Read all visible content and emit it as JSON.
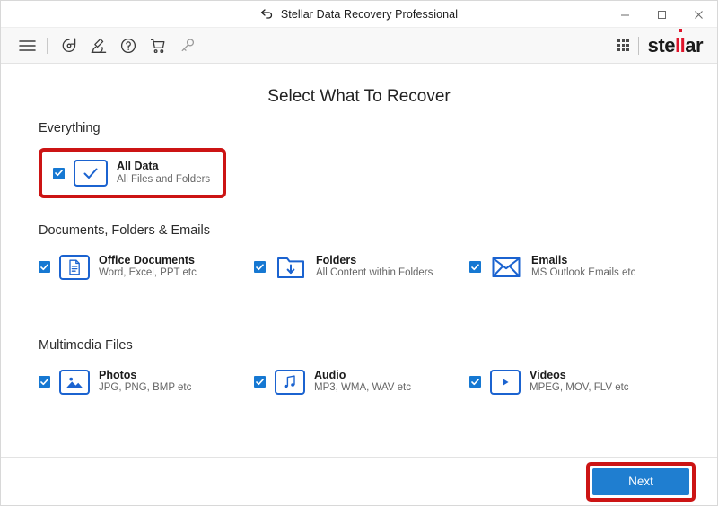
{
  "window": {
    "title": "Stellar Data Recovery Professional",
    "back_icon": "back-arrow-icon",
    "controls": {
      "minimize": "minimize-icon",
      "maximize": "maximize-icon",
      "close": "close-icon"
    }
  },
  "toolbar": {
    "icons": [
      {
        "name": "hamburger-menu-icon",
        "title": "Menu"
      },
      {
        "name": "recovery-history-icon",
        "title": "Recovery"
      },
      {
        "name": "microscope-icon",
        "title": "Monitor Drive"
      },
      {
        "name": "help-icon",
        "title": "Help"
      },
      {
        "name": "cart-icon",
        "title": "Buy Now"
      },
      {
        "name": "key-icon",
        "title": "Activation"
      }
    ],
    "logo": {
      "grid": "app-grid-icon",
      "brand_prefix": "ste",
      "brand_highlight": "ll",
      "brand_suffix": "ar"
    }
  },
  "main": {
    "page_title": "Select What To Recover",
    "sections": [
      {
        "id": "everything",
        "heading": "Everything",
        "highlighted": true,
        "items": [
          {
            "id": "all-data",
            "title": "All Data",
            "subtitle": "All Files and Folders",
            "icon": "check-tile-icon",
            "checked": true
          }
        ]
      },
      {
        "id": "documents",
        "heading": "Documents, Folders & Emails",
        "highlighted": false,
        "items": [
          {
            "id": "office-documents",
            "title": "Office Documents",
            "subtitle": "Word, Excel, PPT etc",
            "icon": "document-icon",
            "checked": true
          },
          {
            "id": "folders",
            "title": "Folders",
            "subtitle": "All Content within Folders",
            "icon": "folder-download-icon",
            "checked": true
          },
          {
            "id": "emails",
            "title": "Emails",
            "subtitle": "MS Outlook Emails etc",
            "icon": "envelope-icon",
            "checked": true
          }
        ]
      },
      {
        "id": "multimedia",
        "heading": "Multimedia Files",
        "highlighted": false,
        "items": [
          {
            "id": "photos",
            "title": "Photos",
            "subtitle": "JPG, PNG, BMP etc",
            "icon": "image-icon",
            "checked": true
          },
          {
            "id": "audio",
            "title": "Audio",
            "subtitle": "MP3, WMA, WAV etc",
            "icon": "music-note-icon",
            "checked": true
          },
          {
            "id": "videos",
            "title": "Videos",
            "subtitle": "MPEG, MOV, FLV etc",
            "icon": "play-icon",
            "checked": true
          }
        ]
      }
    ]
  },
  "footer": {
    "next_label": "Next",
    "next_highlighted": true
  },
  "colors": {
    "accent_blue": "#1f7ed0",
    "icon_blue": "#1b63d0",
    "checkbox_blue": "#1678d2",
    "highlight_red": "#cc1414",
    "brand_red": "#e0152b",
    "toolbar_bg": "#f8f8f8"
  }
}
